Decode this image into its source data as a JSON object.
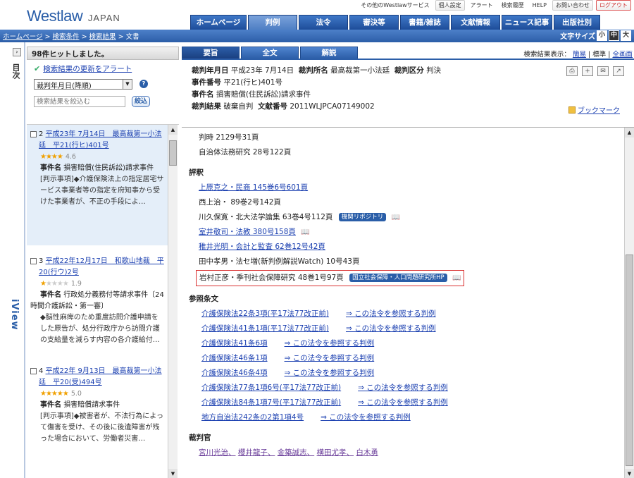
{
  "header": {
    "logo_main": "Westlaw",
    "logo_sub": "JAPAN",
    "util": [
      {
        "label": "その他のWestlawサービス"
      },
      {
        "label": "個人設定"
      },
      {
        "label": "アラート"
      },
      {
        "label": "検索履歴"
      },
      {
        "label": "HELP"
      },
      {
        "label": "お問い合わせ"
      },
      {
        "label": "ログアウト"
      }
    ],
    "tabs": [
      {
        "label": "ホームページ"
      },
      {
        "label": "判例"
      },
      {
        "label": "法令"
      },
      {
        "label": "審決等"
      },
      {
        "label": "書籍/雑誌"
      },
      {
        "label": "文献情報"
      },
      {
        "label": "ニュース記事"
      },
      {
        "label": "出版社別"
      }
    ],
    "breadcrumb": [
      "ホームページ",
      "検索条件",
      "検索結果",
      "文書"
    ],
    "fontsize_label": "文字サイズ",
    "fontsize_options": [
      "小",
      "中",
      "大"
    ]
  },
  "leftbar": {
    "toggle": "›",
    "mokuji": "目次",
    "iview": "iView"
  },
  "sidebar": {
    "hits": "98件ヒットしました。",
    "alert_link": "検索結果の更新をアラート",
    "sort_value": "裁判年月日(降順)",
    "narrow_placeholder": "検索結果を絞込む",
    "narrow_button": "絞込",
    "items": [
      {
        "num": "2",
        "title": "平成23年 7月14日　最高裁第一小法廷　平21(行ヒ)401号",
        "stars": "★★★★",
        "stars_dim": "",
        "score": "4.6",
        "label": "事件名",
        "case": "損害賠償(住民訴訟)請求事件",
        "body": "[判示事項]◆介護保険法上の指定居宅サービス事業者等の指定を府知事から受けた事業者が、不正の手段によ…"
      },
      {
        "num": "3",
        "title": "平成22年12月17日　和歌山地裁　平20(行ウ)2号",
        "stars": "★",
        "stars_dim": "★★★★",
        "score": "1.9",
        "label": "事件名",
        "case": "行政処分義務付等請求事件〔24時間介護訴訟・第一審〕",
        "body": "◆脳性麻痺のため重度訪問介護申請をした原告が、処分行政庁から訪問介護の支給量を減らす内容の各介護給付…"
      },
      {
        "num": "4",
        "title": "平成22年 9月13日　最高裁第一小法廷　平20(受)494号",
        "stars": "★★★★★",
        "stars_dim": "",
        "score": "5.0",
        "label": "事件名",
        "case": "損害賠償請求事件",
        "body": "[判示事項]◆被害者が、不法行為によって傷害を受け、その後に後遺障害が残った場合において、労働者災害…"
      }
    ]
  },
  "content": {
    "tabs": [
      {
        "label": "要旨"
      },
      {
        "label": "全文"
      },
      {
        "label": "解説"
      }
    ],
    "display_label": "検索結果表示：",
    "display_options": [
      "簡易",
      "標準",
      "全画面"
    ],
    "meta": {
      "date_label": "裁判年月日",
      "date": "平成23年 7月14日",
      "court_label": "裁判所名",
      "court": "最高裁第一小法廷",
      "type_label": "裁判区分",
      "type": "判決",
      "case_no_label": "事件番号",
      "case_no": "平21(行ヒ)401号",
      "case_name_label": "事件名",
      "case_name": "損害賠償(住民訴訟)請求事件",
      "result_label": "裁判結果",
      "result": "破棄自判",
      "doc_label": "文献番号",
      "doc": "2011WLJPCA07149002"
    },
    "bookmark": "ブックマーク",
    "refs_top": [
      "判時 2129号31頁",
      "自治体法務研究 28号122頁"
    ],
    "hyoshaku_title": "評釈",
    "hyoshaku": [
      {
        "text": "上原克之・民商 145巻6号601頁",
        "link": true
      },
      {
        "text": "西上治・ 89巻2号142頁",
        "link": false
      },
      {
        "text": "川久保寛・北大法学論集 63巻4号112頁",
        "link": false,
        "badge": "機関リポジトリ",
        "book": true
      },
      {
        "text": "室井敬司・法教 380号158頁",
        "link": true,
        "book": true
      },
      {
        "text": "稚井光明・会計と監査 62巻12号42頁",
        "link": true
      },
      {
        "text": "田中孝男・法セ増(新判例解説Watch) 10号43頁",
        "link": false
      },
      {
        "text": "岩村正彦・季刊社会保障研究 48巻1号97頁",
        "link": false,
        "badge": "国立社会保障・人口問題研究所HP",
        "book": true,
        "highlight": true
      }
    ],
    "sanshou_title": "参照条文",
    "laws": [
      {
        "law": "介護保険法22条3項(平17法77改正前)",
        "ref": "⇒ この法令を参照する判例"
      },
      {
        "law": "介護保険法41条1項(平17法77改正前)",
        "ref": "⇒ この法令を参照する判例"
      },
      {
        "law": "介護保険法41条6項",
        "ref": "⇒ この法令を参照する判例"
      },
      {
        "law": "介護保険法46条1項",
        "ref": "⇒ この法令を参照する判例"
      },
      {
        "law": "介護保険法46条4項",
        "ref": "⇒ この法令を参照する判例"
      },
      {
        "law": "介護保険法77条1項6号(平17法77改正前)",
        "ref": "⇒ この法令を参照する判例"
      },
      {
        "law": "介護保険法84条1項7号(平17法77改正前)",
        "ref": "⇒ この法令を参照する判例"
      },
      {
        "law": "地方自治法242条の2第1項4号",
        "ref": "⇒ この法令を参照する判例"
      }
    ],
    "judges_title": "裁判官",
    "judges": [
      "宮川光治、",
      "櫻井龍子、",
      "金築誠志、",
      "横田尤孝、",
      "白木勇"
    ]
  }
}
